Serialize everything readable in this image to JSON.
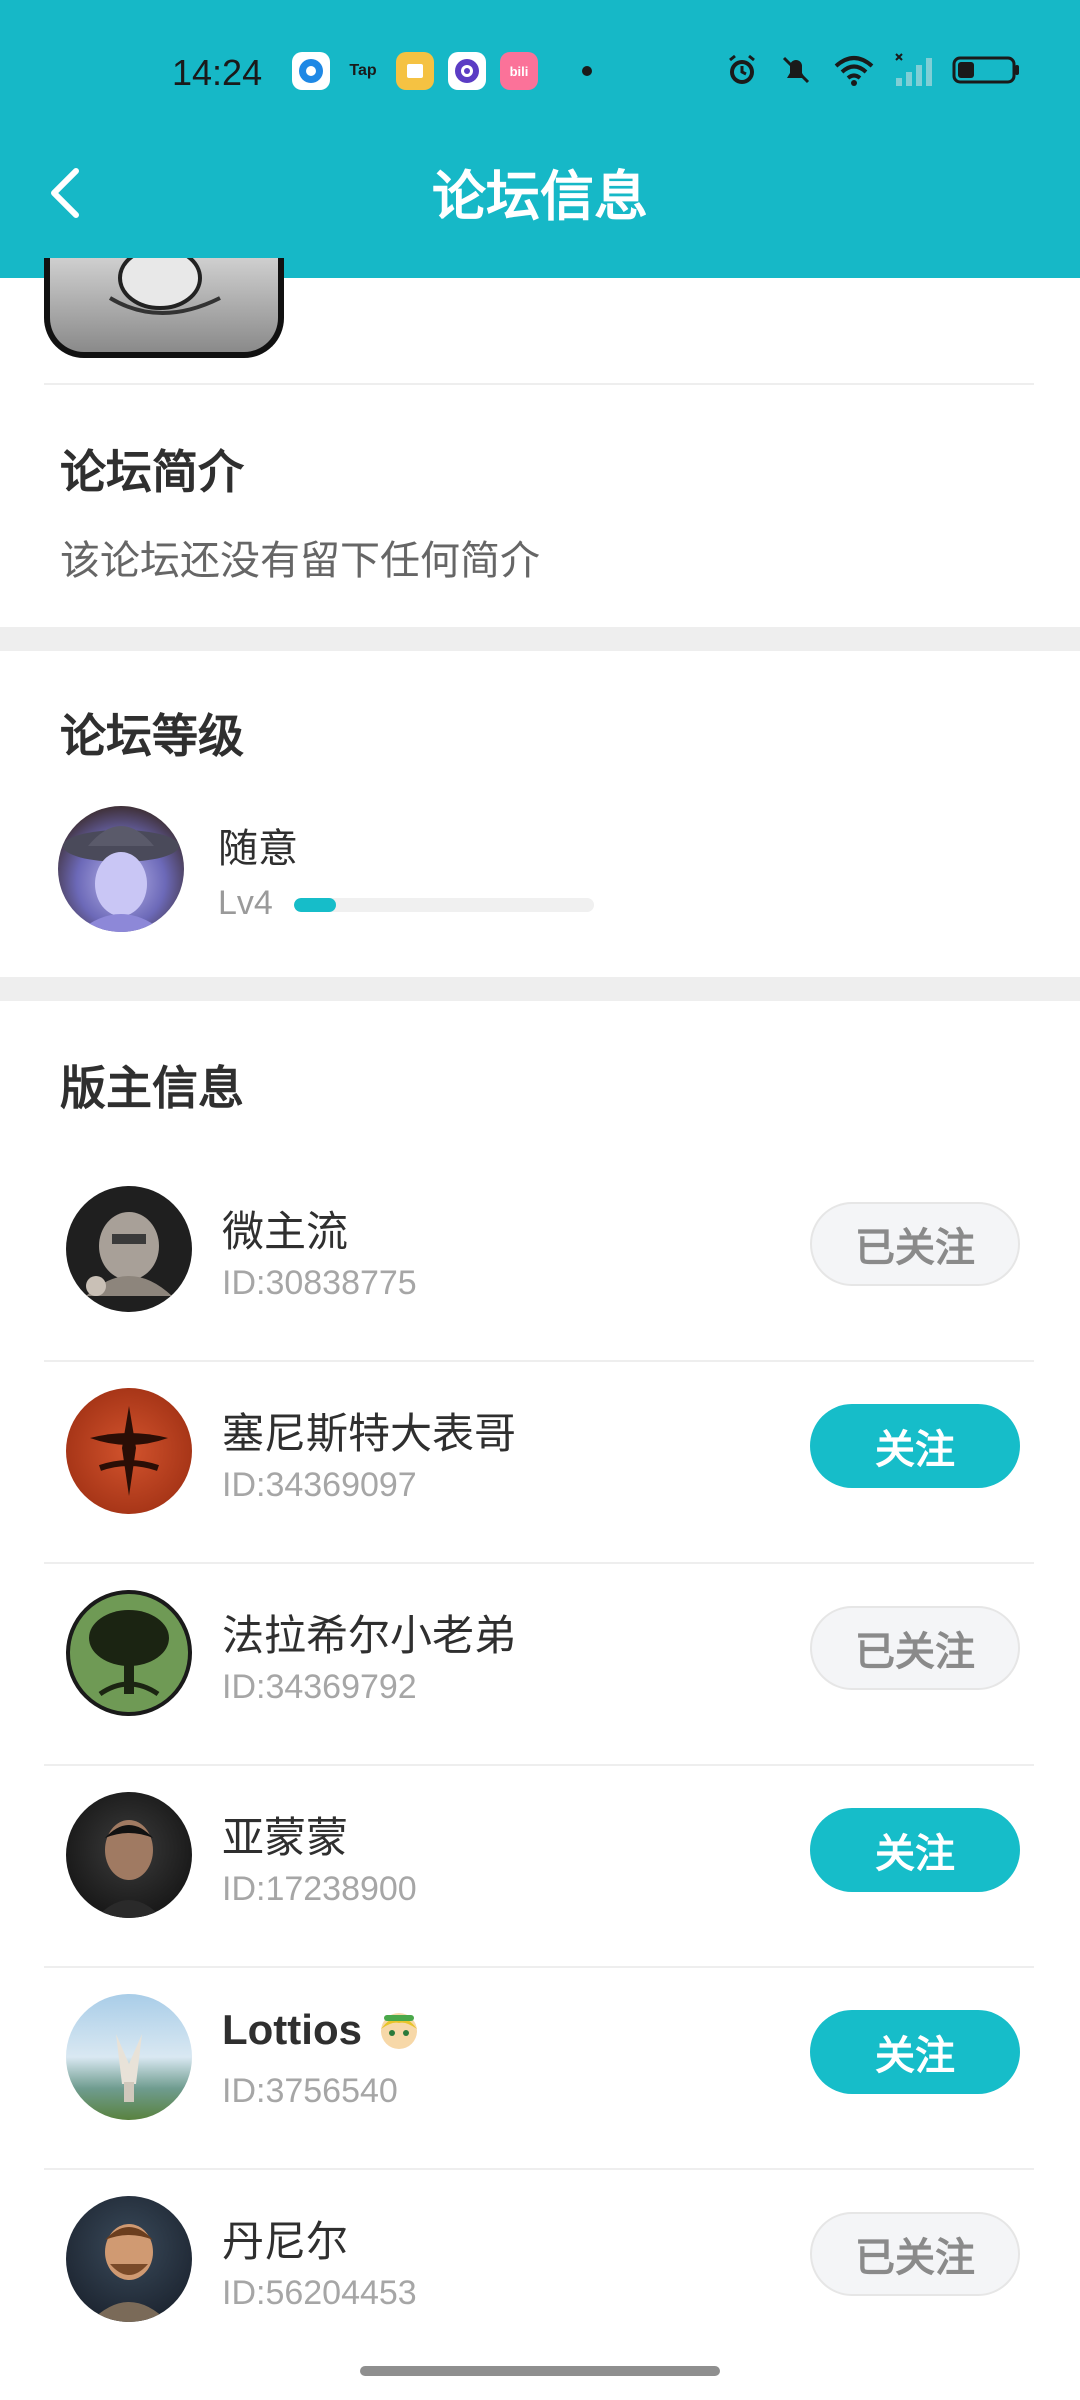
{
  "status_bar": {
    "time": "14:24",
    "apps": [
      {
        "icon": "circle-app-icon",
        "label": "",
        "bg": "#1e88e5"
      },
      {
        "icon": "taptap-icon",
        "label": "Tap",
        "bg": "#16b8c7"
      },
      {
        "icon": "book-app-icon",
        "label": "",
        "bg": "#f5c242"
      },
      {
        "icon": "orbit-app-icon",
        "label": "",
        "bg": "#5b3cc4"
      },
      {
        "icon": "bilibili-icon",
        "label": "bili",
        "bg": "#fb7299"
      }
    ]
  },
  "header": {
    "title": "论坛信息",
    "background": "#16b8c7"
  },
  "intro": {
    "title": "论坛简介",
    "text": "该论坛还没有留下任何简介"
  },
  "level": {
    "title": "论坛等级",
    "name": "随意",
    "tag": "Lv4",
    "progress_fraction": 0.14
  },
  "moderators": {
    "title": "版主信息",
    "items": [
      {
        "name": "微主流",
        "id": "ID:30838775",
        "button": "已关注",
        "followed": true,
        "avatar": "knight-armor-avatar"
      },
      {
        "name": "塞尼斯特大表哥",
        "id": "ID:34369097",
        "button": "关注",
        "followed": false,
        "avatar": "red-emblem-avatar"
      },
      {
        "name": "法拉希尔小老弟",
        "id": "ID:34369792",
        "button": "已关注",
        "followed": true,
        "avatar": "green-tree-avatar"
      },
      {
        "name": "亚蒙蒙",
        "id": "ID:17238900",
        "button": "关注",
        "followed": false,
        "avatar": "dark-portrait-avatar"
      },
      {
        "name": "Lottios",
        "id": "ID:3756540",
        "button": "关注",
        "followed": false,
        "avatar": "landscape-avatar",
        "badge": "anime-girl-emoji-icon"
      },
      {
        "name": "丹尼尔",
        "id": "ID:56204453",
        "button": "已关注",
        "followed": true,
        "avatar": "bearded-man-avatar"
      }
    ]
  },
  "colors": {
    "accent": "#16bdc9",
    "divider": "#eeeeee"
  }
}
